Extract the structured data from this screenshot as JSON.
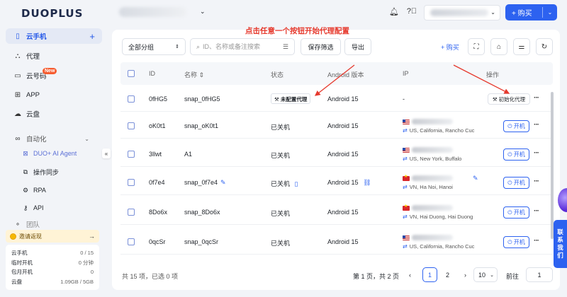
{
  "logo": "DUOPLUS",
  "sidebar": {
    "items": [
      {
        "label": "云手机",
        "icon": "phone-icon"
      },
      {
        "label": "代理",
        "icon": "proxy-icon"
      },
      {
        "label": "云号码",
        "icon": "sim-icon",
        "badge": "New"
      },
      {
        "label": "APP",
        "icon": "app-grid-icon"
      },
      {
        "label": "云盘",
        "icon": "cloud-icon"
      },
      {
        "label": "自动化",
        "icon": "automation-icon"
      }
    ],
    "sub_items": [
      {
        "label": "DUO+ AI Agent",
        "icon": "ai-agent-icon"
      },
      {
        "label": "操作同步",
        "icon": "sync-icon"
      },
      {
        "label": "RPA",
        "icon": "rpa-icon"
      },
      {
        "label": "API",
        "icon": "api-icon"
      }
    ],
    "partial_item": "团队",
    "invite_label": "邀请返现",
    "quota": [
      {
        "label": "云手机",
        "value": "0 / 15"
      },
      {
        "label": "临时开机",
        "value": "0 分钟"
      },
      {
        "label": "包月开机",
        "value": "0"
      },
      {
        "label": "云盘",
        "value": "1.09GB / 5GB"
      }
    ]
  },
  "topbar": {
    "buy_label": "+ 购买"
  },
  "toolbar": {
    "group_select": "全部分组",
    "search_placeholder": "ID、名称或备注搜索",
    "save_filter": "保存筛选",
    "export": "导出",
    "buy_link": "+ 购买"
  },
  "table": {
    "headers": [
      "ID",
      "名称",
      "状态",
      "Android 版本",
      "IP",
      "操作"
    ],
    "rows": [
      {
        "id": "0fHG5",
        "name": "snap_0fHG5",
        "status": "未配置代理",
        "android": "Android 15",
        "ip_flag": "none",
        "ip_location": "-",
        "action": "初始化代理"
      },
      {
        "id": "oK0t1",
        "name": "snap_oK0t1",
        "status": "已关机",
        "android": "Android 15",
        "ip_flag": "us",
        "ip_location": "US, California, Rancho Cuc",
        "action": "开机"
      },
      {
        "id": "3llwt",
        "name": "A1",
        "status": "已关机",
        "android": "Android 15",
        "ip_flag": "us",
        "ip_location": "US, New York, Buffalo",
        "action": "开机"
      },
      {
        "id": "0f7e4",
        "name": "snap_0f7e4",
        "status": "已关机",
        "android": "Android 15",
        "ip_flag": "vn",
        "ip_location": "VN, Ha Noi, Hanoi",
        "action": "开机"
      },
      {
        "id": "8Do6x",
        "name": "snap_8Do6x",
        "status": "已关机",
        "android": "Android 15",
        "ip_flag": "vn",
        "ip_location": "VN, Hai Duong, Hai Duong",
        "action": "开机"
      },
      {
        "id": "0qcSr",
        "name": "snap_0qcSr",
        "status": "已关机",
        "android": "Android 15",
        "ip_flag": "us",
        "ip_location": "US, California, Rancho Cuc",
        "action": "开机"
      }
    ]
  },
  "annotation": "点击任意一个按钮开始代理配置",
  "footer": {
    "summary": "共 15 项，已选 0 项",
    "page_info": "第 1 页，共 2 页",
    "pages": [
      "1",
      "2"
    ],
    "page_size": "10",
    "goto_label": "前往",
    "goto_value": "1"
  },
  "contact_label": [
    "联",
    "系",
    "我",
    "们"
  ],
  "colors": {
    "accent": "#2d62f0",
    "annotation": "#e6392d",
    "active_nav_bg": "#e4e9f5"
  }
}
